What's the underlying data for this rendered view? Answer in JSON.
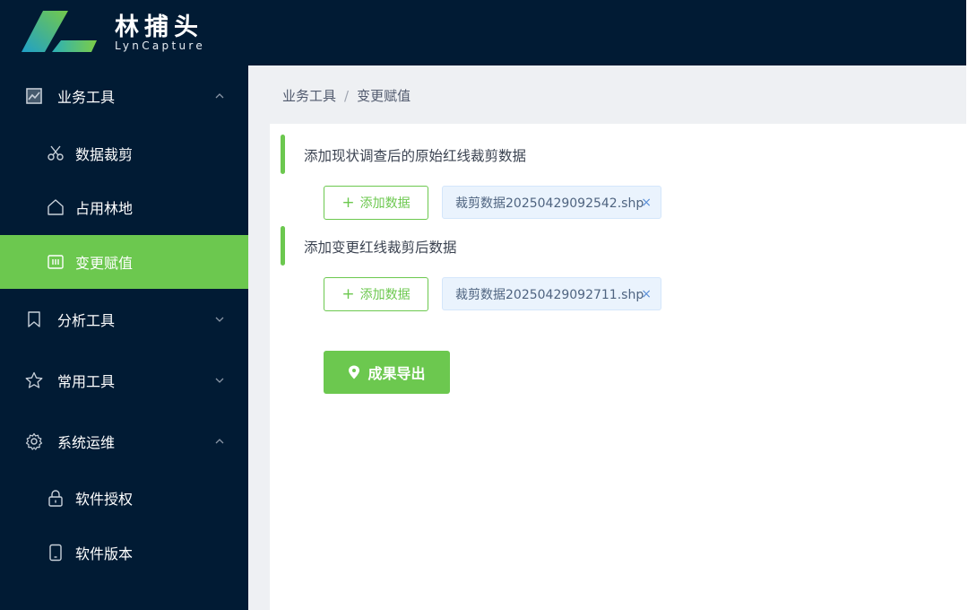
{
  "app": {
    "name": "林捕头",
    "subtitle": "LynCapture",
    "colors": {
      "header_bg": "#011b34",
      "accent": "#6cc84f",
      "tag_bg": "#eaf3fd"
    }
  },
  "sidebar": {
    "groups": [
      {
        "label": "业务工具",
        "icon": "chart-icon",
        "expanded": true,
        "items": [
          {
            "label": "数据裁剪",
            "icon": "scissors-icon"
          },
          {
            "label": "占用林地",
            "icon": "home-icon"
          },
          {
            "label": "变更赋值",
            "icon": "calculator-icon",
            "active": true
          }
        ]
      },
      {
        "label": "分析工具",
        "icon": "bookmark-icon",
        "expanded": false
      },
      {
        "label": "常用工具",
        "icon": "star-icon",
        "expanded": false
      },
      {
        "label": "系统运维",
        "icon": "gear-icon",
        "expanded": true,
        "items": [
          {
            "label": "软件授权",
            "icon": "lock-icon"
          },
          {
            "label": "软件版本",
            "icon": "mobile-icon"
          }
        ]
      }
    ]
  },
  "breadcrumb": {
    "items": [
      "业务工具",
      "变更赋值"
    ],
    "separator": "/"
  },
  "sections": [
    {
      "title": "添加现状调查后的原始红线裁剪数据",
      "add_label": "添加数据",
      "file": "裁剪数据20250429092542.shp"
    },
    {
      "title": "添加变更红线裁剪后数据",
      "add_label": "添加数据",
      "file": "裁剪数据20250429092711.shp"
    }
  ],
  "export": {
    "label": "成果导出",
    "icon": "pin-icon"
  }
}
